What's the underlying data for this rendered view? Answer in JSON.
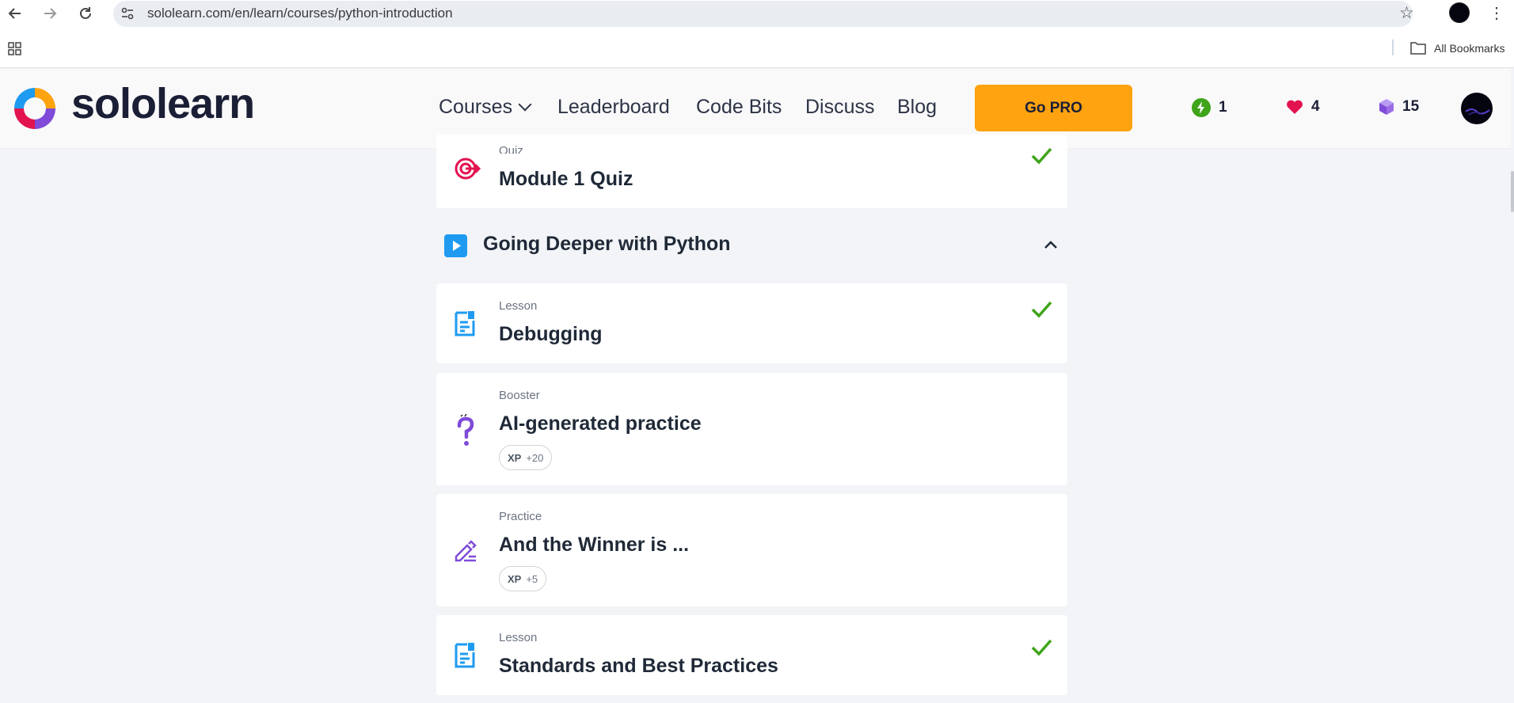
{
  "browser": {
    "url": "sololearn.com/en/learn/courses/python-introduction",
    "bookmarks_label": "All Bookmarks"
  },
  "header": {
    "logo_text": "sololearn",
    "nav": {
      "courses": "Courses",
      "leaderboard": "Leaderboard",
      "code_bits": "Code Bits",
      "discuss": "Discuss",
      "blog": "Blog"
    },
    "go_pro": "Go PRO",
    "stats": {
      "streak": "1",
      "hearts": "4",
      "bits": "15"
    }
  },
  "items": {
    "quiz": {
      "type": "Quiz",
      "title": "Module 1 Quiz",
      "completed": true
    },
    "section": {
      "title": "Going Deeper with Python",
      "expanded": true
    },
    "debugging": {
      "type": "Lesson",
      "title": "Debugging",
      "completed": true
    },
    "ai_practice": {
      "type": "Booster",
      "title": "AI-generated practice",
      "xp_label": "XP",
      "xp_value": "+20"
    },
    "winner": {
      "type": "Practice",
      "title": "And the Winner is ...",
      "xp_label": "XP",
      "xp_value": "+5"
    },
    "standards": {
      "type": "Lesson",
      "title": "Standards and Best Practices",
      "completed": true
    }
  },
  "colors": {
    "accent_pro": "#ffa310",
    "check_green": "#3fa41a",
    "lesson_blue": "#1e9bf0",
    "quiz_red": "#e2134f",
    "purple": "#7f4bd8"
  }
}
